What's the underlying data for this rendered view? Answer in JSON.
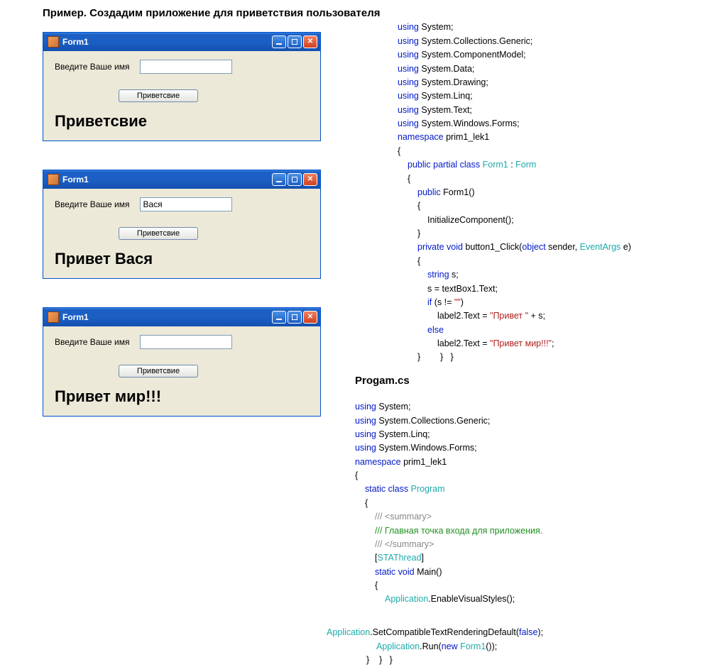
{
  "heading": "Пример. Создадим приложение для приветствия пользователя",
  "windows": [
    {
      "title": "Form1",
      "label": "Введите Ваше имя",
      "input": "",
      "button": "Приветсвие",
      "result": "Приветсвие"
    },
    {
      "title": "Form1",
      "label": "Введите Ваше имя",
      "input": "Вася",
      "button": "Приветсвие",
      "result": "Привет Вася"
    },
    {
      "title": "Form1",
      "label": "Введите Ваше имя",
      "input": "",
      "button": "Приветсвие",
      "result": "Привет мир!!!"
    }
  ],
  "code1": {
    "l01a": "using",
    "l01b": " System;",
    "l02a": "using",
    "l02b": " System.Collections.Generic;",
    "l03a": "using",
    "l03b": " System.ComponentModel;",
    "l04a": "using",
    "l04b": " System.Data;",
    "l05a": "using",
    "l05b": " System.Drawing;",
    "l06a": "using",
    "l06b": " System.Linq;",
    "l07a": "using",
    "l07b": " System.Text;",
    "l08a": "using",
    "l08b": " System.Windows.Forms;",
    "l09a": "namespace",
    "l09b": " prim1_lek1",
    "l10": "{",
    "l11a": "public partial class ",
    "l11b": "Form1",
    "l11c": " : ",
    "l11d": "Form",
    "l12": "{",
    "l13a": "public",
    "l13b": " Form1()",
    "l14": "{",
    "l15": "InitializeComponent();",
    "l16": "}",
    "l17a": "private void",
    "l17b": " button1_Click(",
    "l17c": "object",
    "l17d": " sender, ",
    "l17e": "EventArgs",
    "l17f": " e)",
    "l18": "{",
    "l19a": "string",
    "l19b": " s;",
    "l20": "s = textBox1.Text;",
    "l21a": "if",
    "l21b": " (s != ",
    "l21c": "\"\"",
    "l21d": ")",
    "l22a": "label2.Text = ",
    "l22b": "\"Привет \"",
    "l22c": " + s;",
    "l23": "else",
    "l24a": "label2.Text = ",
    "l24b": "\"Привет мир!!!\"",
    "l24c": ";",
    "l25": "}        }   }"
  },
  "code2title": "Progam.cs",
  "code2": {
    "l01a": "using",
    "l01b": " System;",
    "l02a": "using",
    "l02b": " System.Collections.Generic;",
    "l03a": "using",
    "l03b": " System.Linq;",
    "l04a": "using",
    "l04b": " System.Windows.Forms;",
    "l05a": "namespace",
    "l05b": " prim1_lek1",
    "l06": "{",
    "l07a": "static class ",
    "l07b": "Program",
    "l08": "{",
    "l09": "/// <summary>",
    "l10": "/// Главная точка входа для приложения.",
    "l11": "/// </summary>",
    "l12a": "[",
    "l12b": "STAThread",
    "l12c": "]",
    "l13a": "static void",
    "l13b": " Main()",
    "l14": "{",
    "l15a": "Application",
    "l15b": ".EnableVisualStyles();",
    "l16a": "Application",
    "l16b": ".SetCompatibleTextRenderingDefault(",
    "l16c": "false",
    "l16d": ");",
    "l17a": "Application",
    "l17b": ".Run(",
    "l17c": "new ",
    "l17d": "Form1",
    "l17e": "());",
    "l18": "}    }   }"
  }
}
